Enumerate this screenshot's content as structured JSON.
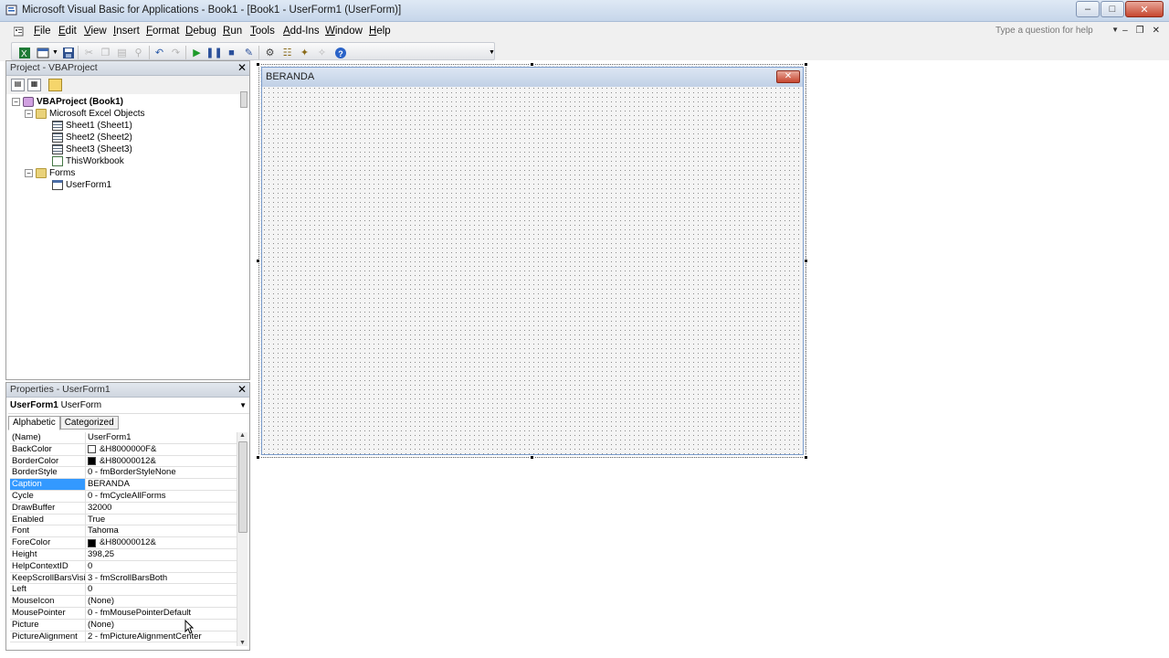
{
  "window": {
    "title": "Microsoft Visual Basic for Applications - Book1 - [Book1 - UserForm1 (UserForm)]"
  },
  "menu": [
    "File",
    "Edit",
    "View",
    "Insert",
    "Format",
    "Debug",
    "Run",
    "Tools",
    "Add-Ins",
    "Window",
    "Help"
  ],
  "help_placeholder": "Type a question for help",
  "project": {
    "title": "Project - VBAProject",
    "tree": {
      "root": "VBAProject (Book1)",
      "folder1": "Microsoft Excel Objects",
      "sheet1": "Sheet1 (Sheet1)",
      "sheet2": "Sheet2 (Sheet2)",
      "sheet3": "Sheet3 (Sheet3)",
      "workbook": "ThisWorkbook",
      "folder2": "Forms",
      "form": "UserForm1"
    }
  },
  "properties": {
    "title": "Properties - UserForm1",
    "object_name": "UserForm1",
    "object_type": "UserForm",
    "tabs": [
      "Alphabetic",
      "Categorized"
    ],
    "rows": [
      {
        "k": "(Name)",
        "v": "UserForm1"
      },
      {
        "k": "BackColor",
        "v": "&H8000000F&",
        "swatch": "#ffffff"
      },
      {
        "k": "BorderColor",
        "v": "&H80000012&",
        "swatch": "#000000"
      },
      {
        "k": "BorderStyle",
        "v": "0 - fmBorderStyleNone"
      },
      {
        "k": "Caption",
        "v": "BERANDA",
        "selected": true
      },
      {
        "k": "Cycle",
        "v": "0 - fmCycleAllForms"
      },
      {
        "k": "DrawBuffer",
        "v": "32000"
      },
      {
        "k": "Enabled",
        "v": "True"
      },
      {
        "k": "Font",
        "v": "Tahoma"
      },
      {
        "k": "ForeColor",
        "v": "&H80000012&",
        "swatch": "#000000"
      },
      {
        "k": "Height",
        "v": "398,25"
      },
      {
        "k": "HelpContextID",
        "v": "0"
      },
      {
        "k": "KeepScrollBarsVisible",
        "v": "3 - fmScrollBarsBoth"
      },
      {
        "k": "Left",
        "v": "0"
      },
      {
        "k": "MouseIcon",
        "v": "(None)"
      },
      {
        "k": "MousePointer",
        "v": "0 - fmMousePointerDefault"
      },
      {
        "k": "Picture",
        "v": "(None)"
      },
      {
        "k": "PictureAlignment",
        "v": "2 - fmPictureAlignmentCenter"
      }
    ]
  },
  "userform": {
    "caption": "BERANDA",
    "close_label": "✕"
  },
  "colors": {
    "selection": "#3399ff",
    "title_gradient": "#c6d6ea"
  }
}
